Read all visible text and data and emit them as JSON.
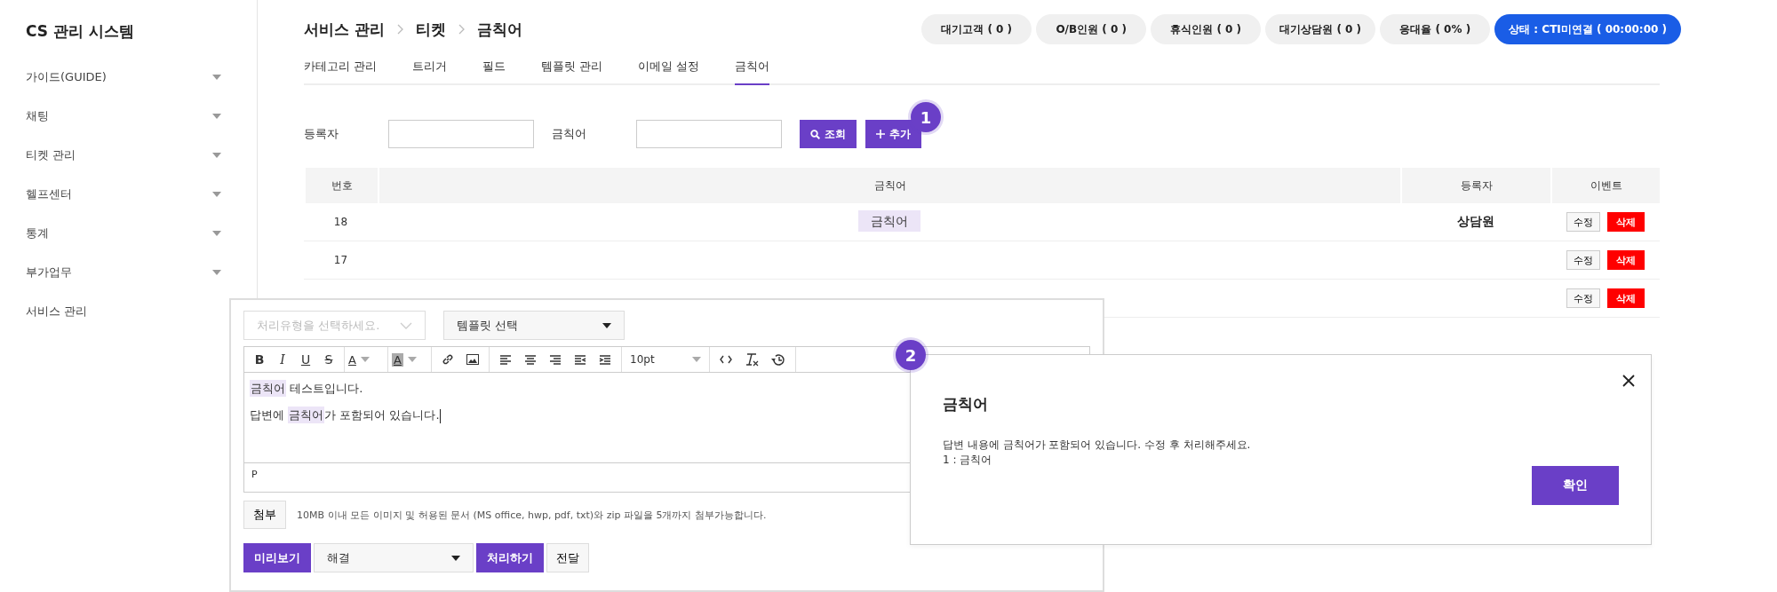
{
  "sidebar": {
    "title": "CS 관리 시스템",
    "items": [
      {
        "label": "가이드(GUIDE)",
        "expandable": true
      },
      {
        "label": "채팅",
        "expandable": true
      },
      {
        "label": "티켓 관리",
        "expandable": true
      },
      {
        "label": "헬프센터",
        "expandable": true
      },
      {
        "label": "통계",
        "expandable": true
      },
      {
        "label": "부가업무",
        "expandable": true
      },
      {
        "label": "서비스 관리",
        "expandable": false
      }
    ]
  },
  "header": {
    "breadcrumb": [
      "서비스 관리",
      "티켓",
      "금칙어"
    ],
    "status_pills": [
      {
        "label": "대기고객 ( 0 )",
        "kind": "count"
      },
      {
        "label": "O/B인원 ( 0 )",
        "kind": "count"
      },
      {
        "label": "휴식인원 ( 0 )",
        "kind": "count"
      },
      {
        "label": "대기상담원 ( 0 )",
        "kind": "count"
      },
      {
        "label": "응대율 ( 0% )",
        "kind": "count"
      },
      {
        "label": "상태 : CTI미연결 ( 00:00:00 )",
        "kind": "status"
      }
    ]
  },
  "tabs": [
    {
      "label": "카테고리 관리",
      "selected": false
    },
    {
      "label": "트리거",
      "selected": false
    },
    {
      "label": "필드",
      "selected": false
    },
    {
      "label": "템플릿 관리",
      "selected": false
    },
    {
      "label": "이메일 설정",
      "selected": false
    },
    {
      "label": "금칙어",
      "selected": true
    }
  ],
  "search": {
    "fields": [
      {
        "label": "등록자"
      },
      {
        "label": "금칙어"
      }
    ],
    "buttons": [
      {
        "label": "조회",
        "kind": "search"
      },
      {
        "label": "추가",
        "kind": "add"
      }
    ],
    "badge": "1"
  },
  "table": {
    "columns": [
      "번호",
      "금칙어",
      "등록자",
      "이벤트"
    ],
    "rows": [
      {
        "number": "18",
        "word": "금칙어",
        "registrant": "상담원",
        "actions": [
          "수정",
          "삭제"
        ]
      },
      {
        "number": "17",
        "actions": [
          "수정",
          "삭제"
        ]
      },
      {
        "actions": [
          "수정",
          "삭제"
        ]
      }
    ]
  },
  "editor": {
    "type_select": {
      "placeholder": "처리유형을 선택하세요."
    },
    "template_select": {
      "value": "템플릿 선택"
    },
    "toolbar": [
      [
        {
          "kind": "bold",
          "label": "B"
        },
        {
          "kind": "italic",
          "label": "I"
        },
        {
          "kind": "underline",
          "label": "U"
        },
        {
          "kind": "strike",
          "label": "S"
        }
      ],
      [
        {
          "kind": "forecolor",
          "label": "A"
        }
      ],
      [
        {
          "kind": "backcolor",
          "label": "A"
        }
      ],
      [
        {
          "kind": "link"
        },
        {
          "kind": "image"
        }
      ],
      [
        {
          "kind": "alignleft"
        },
        {
          "kind": "aligncenter"
        },
        {
          "kind": "alignright"
        },
        {
          "kind": "outdent"
        },
        {
          "kind": "indent"
        }
      ],
      [
        {
          "kind": "size",
          "label": "10pt"
        }
      ],
      [
        {
          "kind": "code"
        },
        {
          "kind": "clear"
        },
        {
          "kind": "history"
        }
      ]
    ],
    "paragraphs": [
      [
        {
          "text": "금칙어",
          "flagged": true
        },
        {
          "text": " 테스트입니다.",
          "flagged": false
        }
      ],
      [
        {
          "text": "답변에 ",
          "flagged": false
        },
        {
          "text": "금칙어",
          "flagged": true
        },
        {
          "text": "가 포함되어 있습니다.",
          "flagged": false
        }
      ]
    ],
    "path": "P",
    "attach_button": "첨부",
    "attach_note": "10MB 이내 모든 이미지 및 허용된 문서 (MS office, hwp, pdf, txt)와 zip 파일을 5개까지 첨부가능합니다.",
    "preview_button": "미리보기",
    "status_select": {
      "value": "해결"
    },
    "process_button": "처리하기",
    "forward_button": "전달",
    "badge": "2"
  },
  "dialog": {
    "title": "금칙어",
    "message": "답변 내용에 금칙어가 포함되어 있습니다. 수정 후 처리해주세요.",
    "detail": "1 : 금칙어",
    "confirm": "확인"
  }
}
